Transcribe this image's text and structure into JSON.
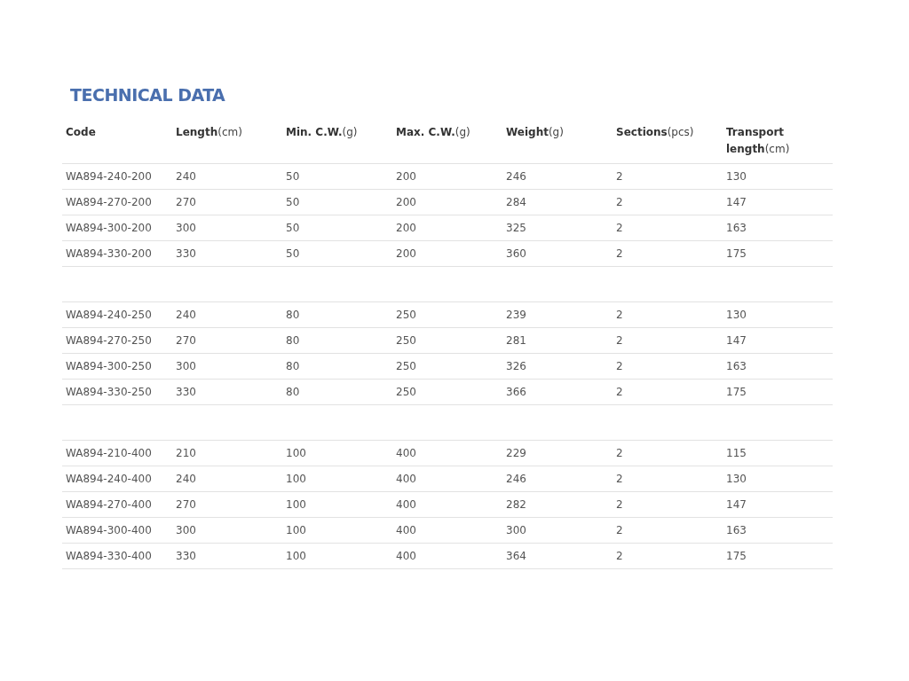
{
  "title": "TECHNICAL DATA",
  "columns": [
    {
      "name": "Code"
    },
    {
      "name": "Length",
      "unit": "(cm)"
    },
    {
      "name": "Min. C.W.",
      "unit": "(g)"
    },
    {
      "name": "Max. C.W.",
      "unit": "(g)"
    },
    {
      "name": "Weight",
      "unit": "(g)"
    },
    {
      "name": "Sections",
      "unit": "(pcs)"
    },
    {
      "name": "Transport length",
      "unit": "(cm)"
    }
  ],
  "groups": [
    {
      "rows": [
        [
          "WA894-240-200",
          "240",
          "50",
          "200",
          "246",
          "2",
          "130"
        ],
        [
          "WA894-270-200",
          "270",
          "50",
          "200",
          "284",
          "2",
          "147"
        ],
        [
          "WA894-300-200",
          "300",
          "50",
          "200",
          "325",
          "2",
          "163"
        ],
        [
          "WA894-330-200",
          "330",
          "50",
          "200",
          "360",
          "2",
          "175"
        ]
      ]
    },
    {
      "rows": [
        [
          "WA894-240-250",
          "240",
          "80",
          "250",
          "239",
          "2",
          "130"
        ],
        [
          "WA894-270-250",
          "270",
          "80",
          "250",
          "281",
          "2",
          "147"
        ],
        [
          "WA894-300-250",
          "300",
          "80",
          "250",
          "326",
          "2",
          "163"
        ],
        [
          "WA894-330-250",
          "330",
          "80",
          "250",
          "366",
          "2",
          "175"
        ]
      ]
    },
    {
      "rows": [
        [
          "WA894-210-400",
          "210",
          "100",
          "400",
          "229",
          "2",
          "115"
        ],
        [
          "WA894-240-400",
          "240",
          "100",
          "400",
          "246",
          "2",
          "130"
        ],
        [
          "WA894-270-400",
          "270",
          "100",
          "400",
          "282",
          "2",
          "147"
        ],
        [
          "WA894-300-400",
          "300",
          "100",
          "400",
          "300",
          "2",
          "163"
        ],
        [
          "WA894-330-400",
          "330",
          "100",
          "400",
          "364",
          "2",
          "175"
        ]
      ]
    }
  ]
}
